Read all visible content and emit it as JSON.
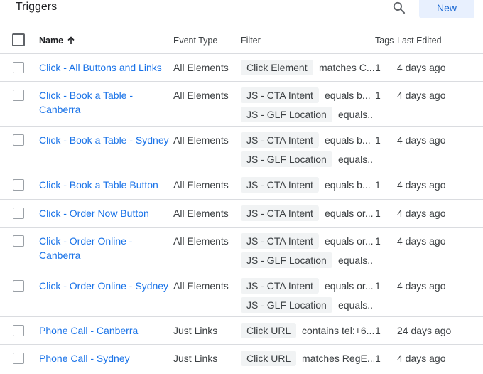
{
  "header": {
    "title": "Triggers",
    "new_label": "New",
    "search_icon": "search-icon"
  },
  "columns": {
    "name": "Name",
    "event_type": "Event Type",
    "filter": "Filter",
    "tags": "Tags",
    "last_edited": "Last Edited",
    "sort_icon": "arrow-up-icon"
  },
  "rows": [
    {
      "name_line1": "Click - All Buttons and Links",
      "name_line2": "",
      "event_type": "All Elements",
      "filter1_var": "Click Element",
      "filter1_val": "matches C...",
      "filter2_var": "",
      "filter2_val": "",
      "tags": "1",
      "last_edited": "4 days ago"
    },
    {
      "name_line1": "Click - Book a Table -",
      "name_line2": "Canberra",
      "event_type": "All Elements",
      "filter1_var": "JS - CTA Intent",
      "filter1_val": "equals b...",
      "filter2_var": "JS - GLF Location",
      "filter2_val": "equals...",
      "tags": "1",
      "last_edited": "4 days ago"
    },
    {
      "name_line1": "Click - Book a Table - Sydney",
      "name_line2": "",
      "event_type": "All Elements",
      "filter1_var": "JS - CTA Intent",
      "filter1_val": "equals b...",
      "filter2_var": "JS - GLF Location",
      "filter2_val": "equals...",
      "tags": "1",
      "last_edited": "4 days ago"
    },
    {
      "name_line1": "Click - Book a Table Button",
      "name_line2": "",
      "event_type": "All Elements",
      "filter1_var": "JS - CTA Intent",
      "filter1_val": "equals b...",
      "filter2_var": "",
      "filter2_val": "",
      "tags": "1",
      "last_edited": "4 days ago"
    },
    {
      "name_line1": "Click - Order Now Button",
      "name_line2": "",
      "event_type": "All Elements",
      "filter1_var": "JS - CTA Intent",
      "filter1_val": "equals or...",
      "filter2_var": "",
      "filter2_val": "",
      "tags": "1",
      "last_edited": "4 days ago"
    },
    {
      "name_line1": "Click - Order Online -",
      "name_line2": "Canberra",
      "event_type": "All Elements",
      "filter1_var": "JS - CTA Intent",
      "filter1_val": "equals or...",
      "filter2_var": "JS - GLF Location",
      "filter2_val": "equals...",
      "tags": "1",
      "last_edited": "4 days ago"
    },
    {
      "name_line1": "Click - Order Online - Sydney",
      "name_line2": "",
      "event_type": "All Elements",
      "filter1_var": "JS - CTA Intent",
      "filter1_val": "equals or...",
      "filter2_var": "JS - GLF Location",
      "filter2_val": "equals...",
      "tags": "1",
      "last_edited": "4 days ago"
    },
    {
      "name_line1": "Phone Call - Canberra",
      "name_line2": "",
      "event_type": "Just Links",
      "filter1_var": "Click URL",
      "filter1_val": "contains tel:+6...",
      "filter2_var": "",
      "filter2_val": "",
      "tags": "1",
      "last_edited": "24 days ago"
    },
    {
      "name_line1": "Phone Call - Sydney",
      "name_line2": "",
      "event_type": "Just Links",
      "filter1_var": "Click URL",
      "filter1_val": "matches RegE...",
      "filter2_var": "",
      "filter2_val": "",
      "tags": "1",
      "last_edited": "4 days ago"
    }
  ]
}
